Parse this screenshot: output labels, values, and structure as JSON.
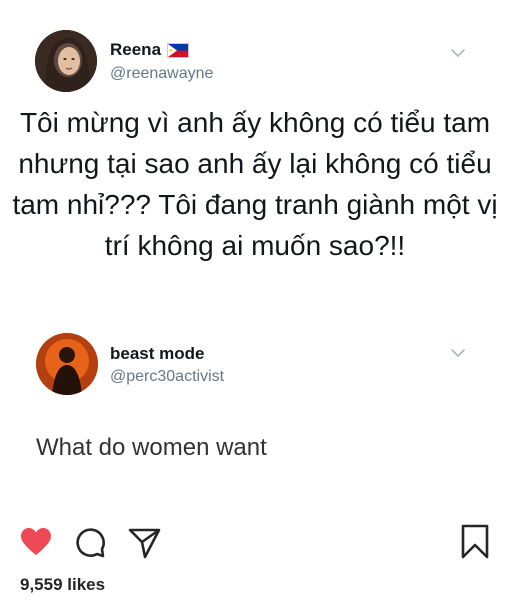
{
  "tweet1": {
    "display_name": "Reena",
    "handle": "@reenawayne",
    "flag_icon": "philippines-flag-icon",
    "text": "Tôi mừng vì anh ấy không có tiểu tam nhưng tại sao anh ấy lại không có tiểu tam nhỉ??? Tôi đang tranh giành một vị trí không ai muốn sao?!!"
  },
  "tweet2": {
    "display_name": "beast mode",
    "handle": "@perc30activist",
    "text": "What do women want"
  },
  "actions": {
    "like_icon": "heart-icon",
    "comment_icon": "comment-icon",
    "share_icon": "send-icon",
    "save_icon": "bookmark-icon",
    "like_color": "#ed4956"
  },
  "likes_text": "9,559 likes"
}
